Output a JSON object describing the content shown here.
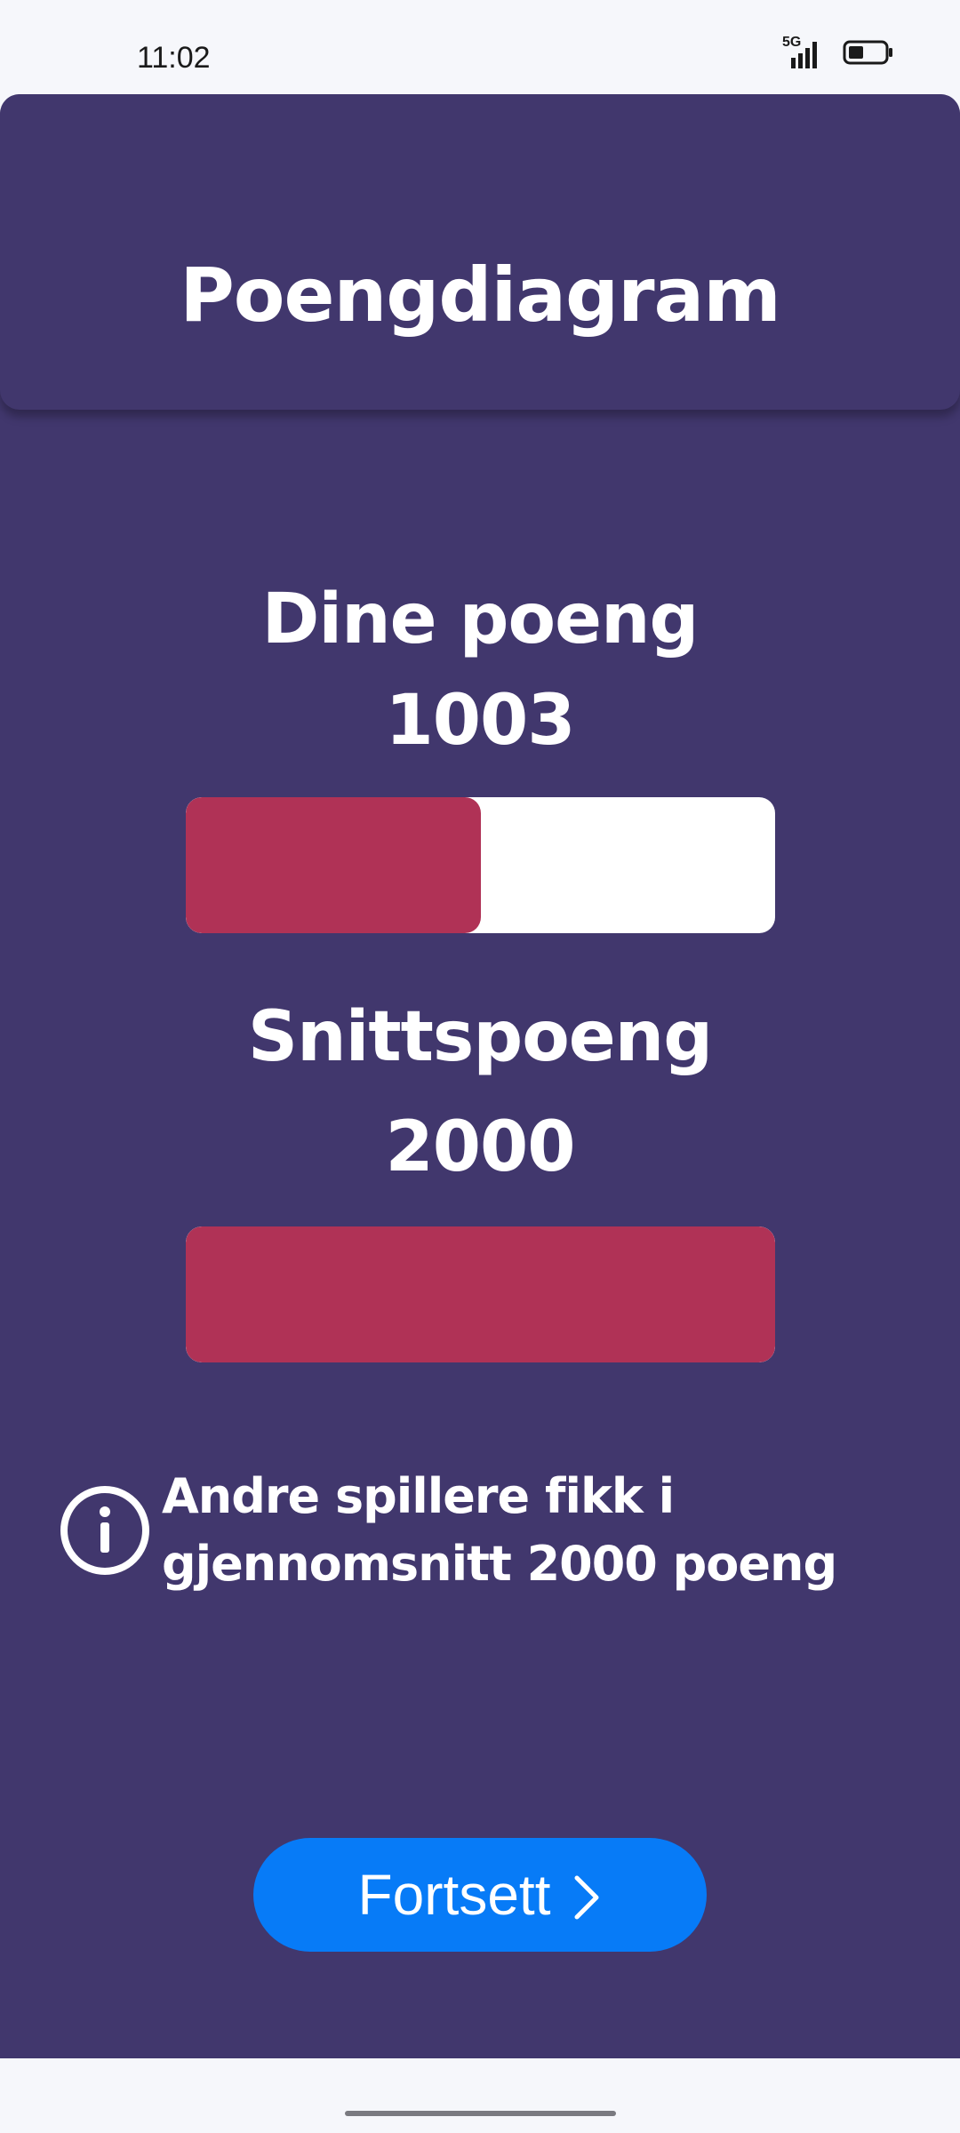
{
  "status_bar": {
    "time": "11:02",
    "network": "5G",
    "icons": [
      "signal-icon",
      "battery-icon"
    ]
  },
  "header": {
    "title": "Poengdiagram"
  },
  "your_score": {
    "label": "Dine poeng",
    "value": "1003",
    "bar_fill_fraction": 0.5
  },
  "average_score": {
    "label": "Snittspoeng",
    "value": "2000",
    "bar_fill_fraction": 1.0
  },
  "info": {
    "icon": "info-icon",
    "line1": "Andre spillere fikk i",
    "line2": "gjennomsnitt 2000 poeng"
  },
  "continue_button": {
    "label": "Fortsett",
    "icon": "chevron-right-icon"
  },
  "colors": {
    "background": "#41376d",
    "bar_fill": "#b03256",
    "bar_track": "#ffffff",
    "button": "#077bf7"
  }
}
